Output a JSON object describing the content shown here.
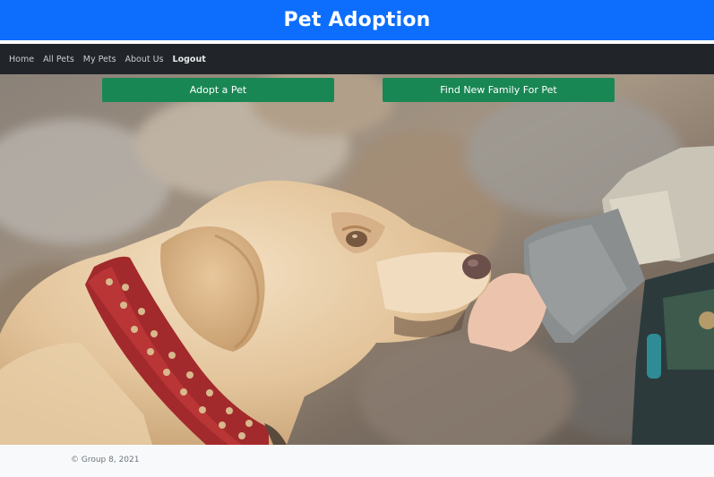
{
  "header": {
    "title": "Pet Adoption"
  },
  "nav": {
    "items": [
      {
        "label": "Home"
      },
      {
        "label": "All Pets"
      },
      {
        "label": "My Pets"
      },
      {
        "label": "About Us"
      },
      {
        "label": "Logout"
      }
    ]
  },
  "hero": {
    "adopt_label": "Adopt a Pet",
    "find_family_label": "Find New Family For Pet"
  },
  "footer": {
    "copyright": "© Group 8, 2021"
  },
  "colors": {
    "header": "#0d6efd",
    "navbar": "#212529",
    "button": "#198754",
    "footer": "#f8f9fa"
  }
}
